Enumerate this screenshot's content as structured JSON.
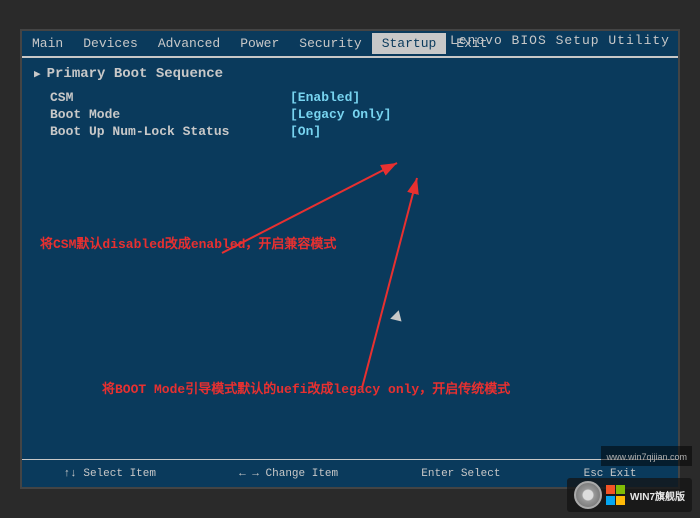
{
  "bios": {
    "title": "Lenovo BIOS Setup Utility",
    "menu_items": [
      {
        "label": "Main",
        "active": false
      },
      {
        "label": "Devices",
        "active": false
      },
      {
        "label": "Advanced",
        "active": false
      },
      {
        "label": "Power",
        "active": false
      },
      {
        "label": "Security",
        "active": false
      },
      {
        "label": "Startup",
        "active": true
      },
      {
        "label": "Exit",
        "active": false
      }
    ],
    "section_title": "Primary Boot Sequence",
    "settings": [
      {
        "name": "CSM",
        "value": "[Enabled]"
      },
      {
        "name": "Boot Mode",
        "value": "[Legacy Only]"
      },
      {
        "name": "Boot Up Num-Lock Status",
        "value": "[On]"
      }
    ],
    "annotation1": "将CSM默认disabled改成enabled，开启兼容模式",
    "annotation2": "将BOOT Mode引导模式默认的uefi改成legacy only，开启传统模式",
    "bottom_keys": [
      "↑↓ Select Item",
      "← → Change Item",
      "Enter Select",
      "Esc Exit"
    ]
  },
  "watermark": {
    "url": "www.win7qijian.com",
    "badge": "WIN7旗舰版"
  }
}
